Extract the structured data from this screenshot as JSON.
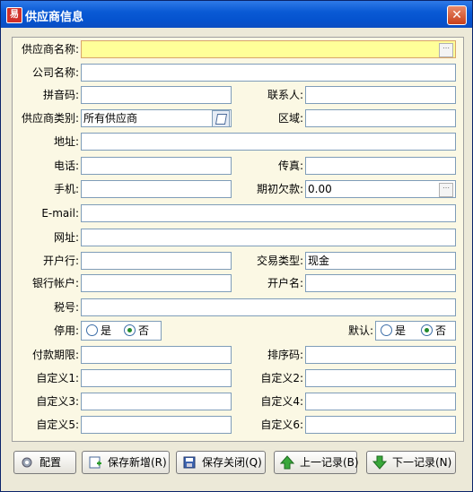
{
  "window": {
    "title": "供应商信息",
    "icon_text": "易",
    "close_symbol": "✕"
  },
  "form": {
    "supplier_name": {
      "label": "供应商名称:",
      "value": ""
    },
    "company_name": {
      "label": "公司名称:",
      "value": ""
    },
    "pinyin_code": {
      "label": "拼音码:",
      "value": ""
    },
    "contact": {
      "label": "联系人:",
      "value": ""
    },
    "supplier_type": {
      "label": "供应商类别:",
      "value": "所有供应商"
    },
    "region": {
      "label": "区域:",
      "value": ""
    },
    "address": {
      "label": "地址:",
      "value": ""
    },
    "phone": {
      "label": "电话:",
      "value": ""
    },
    "fax": {
      "label": "传真:",
      "value": ""
    },
    "mobile": {
      "label": "手机:",
      "value": ""
    },
    "initial_debt": {
      "label": "期初欠款:",
      "value": "0.00"
    },
    "email": {
      "label": "E-mail:",
      "value": ""
    },
    "website": {
      "label": "网址:",
      "value": ""
    },
    "bank": {
      "label": "开户行:",
      "value": ""
    },
    "trade_type": {
      "label": "交易类型:",
      "value": "现金"
    },
    "bank_account": {
      "label": "银行帐户:",
      "value": ""
    },
    "account_name": {
      "label": "开户名:",
      "value": ""
    },
    "tax_number": {
      "label": "税号:",
      "value": ""
    },
    "disabled": {
      "label": "停用:",
      "yes": "是",
      "no": "否",
      "selected": "no"
    },
    "default": {
      "label": "默认:",
      "yes": "是",
      "no": "否",
      "selected": "no"
    },
    "payment_term": {
      "label": "付款期限:",
      "value": ""
    },
    "sort_code": {
      "label": "排序码:",
      "value": ""
    },
    "custom1": {
      "label": "自定义1:",
      "value": ""
    },
    "custom2": {
      "label": "自定义2:",
      "value": ""
    },
    "custom3": {
      "label": "自定义3:",
      "value": ""
    },
    "custom4": {
      "label": "自定义4:",
      "value": ""
    },
    "custom5": {
      "label": "自定义5:",
      "value": ""
    },
    "custom6": {
      "label": "自定义6:",
      "value": ""
    }
  },
  "buttons": {
    "config": "配置",
    "save_new": "保存新增(R)",
    "save_close": "保存关闭(Q)",
    "prev": "上一记录(B)",
    "next": "下一记录(N)"
  },
  "colors": {
    "title_bar": "#0a5ad5",
    "panel_bg": "#fbf8e4",
    "highlight_field": "#ffff99"
  }
}
